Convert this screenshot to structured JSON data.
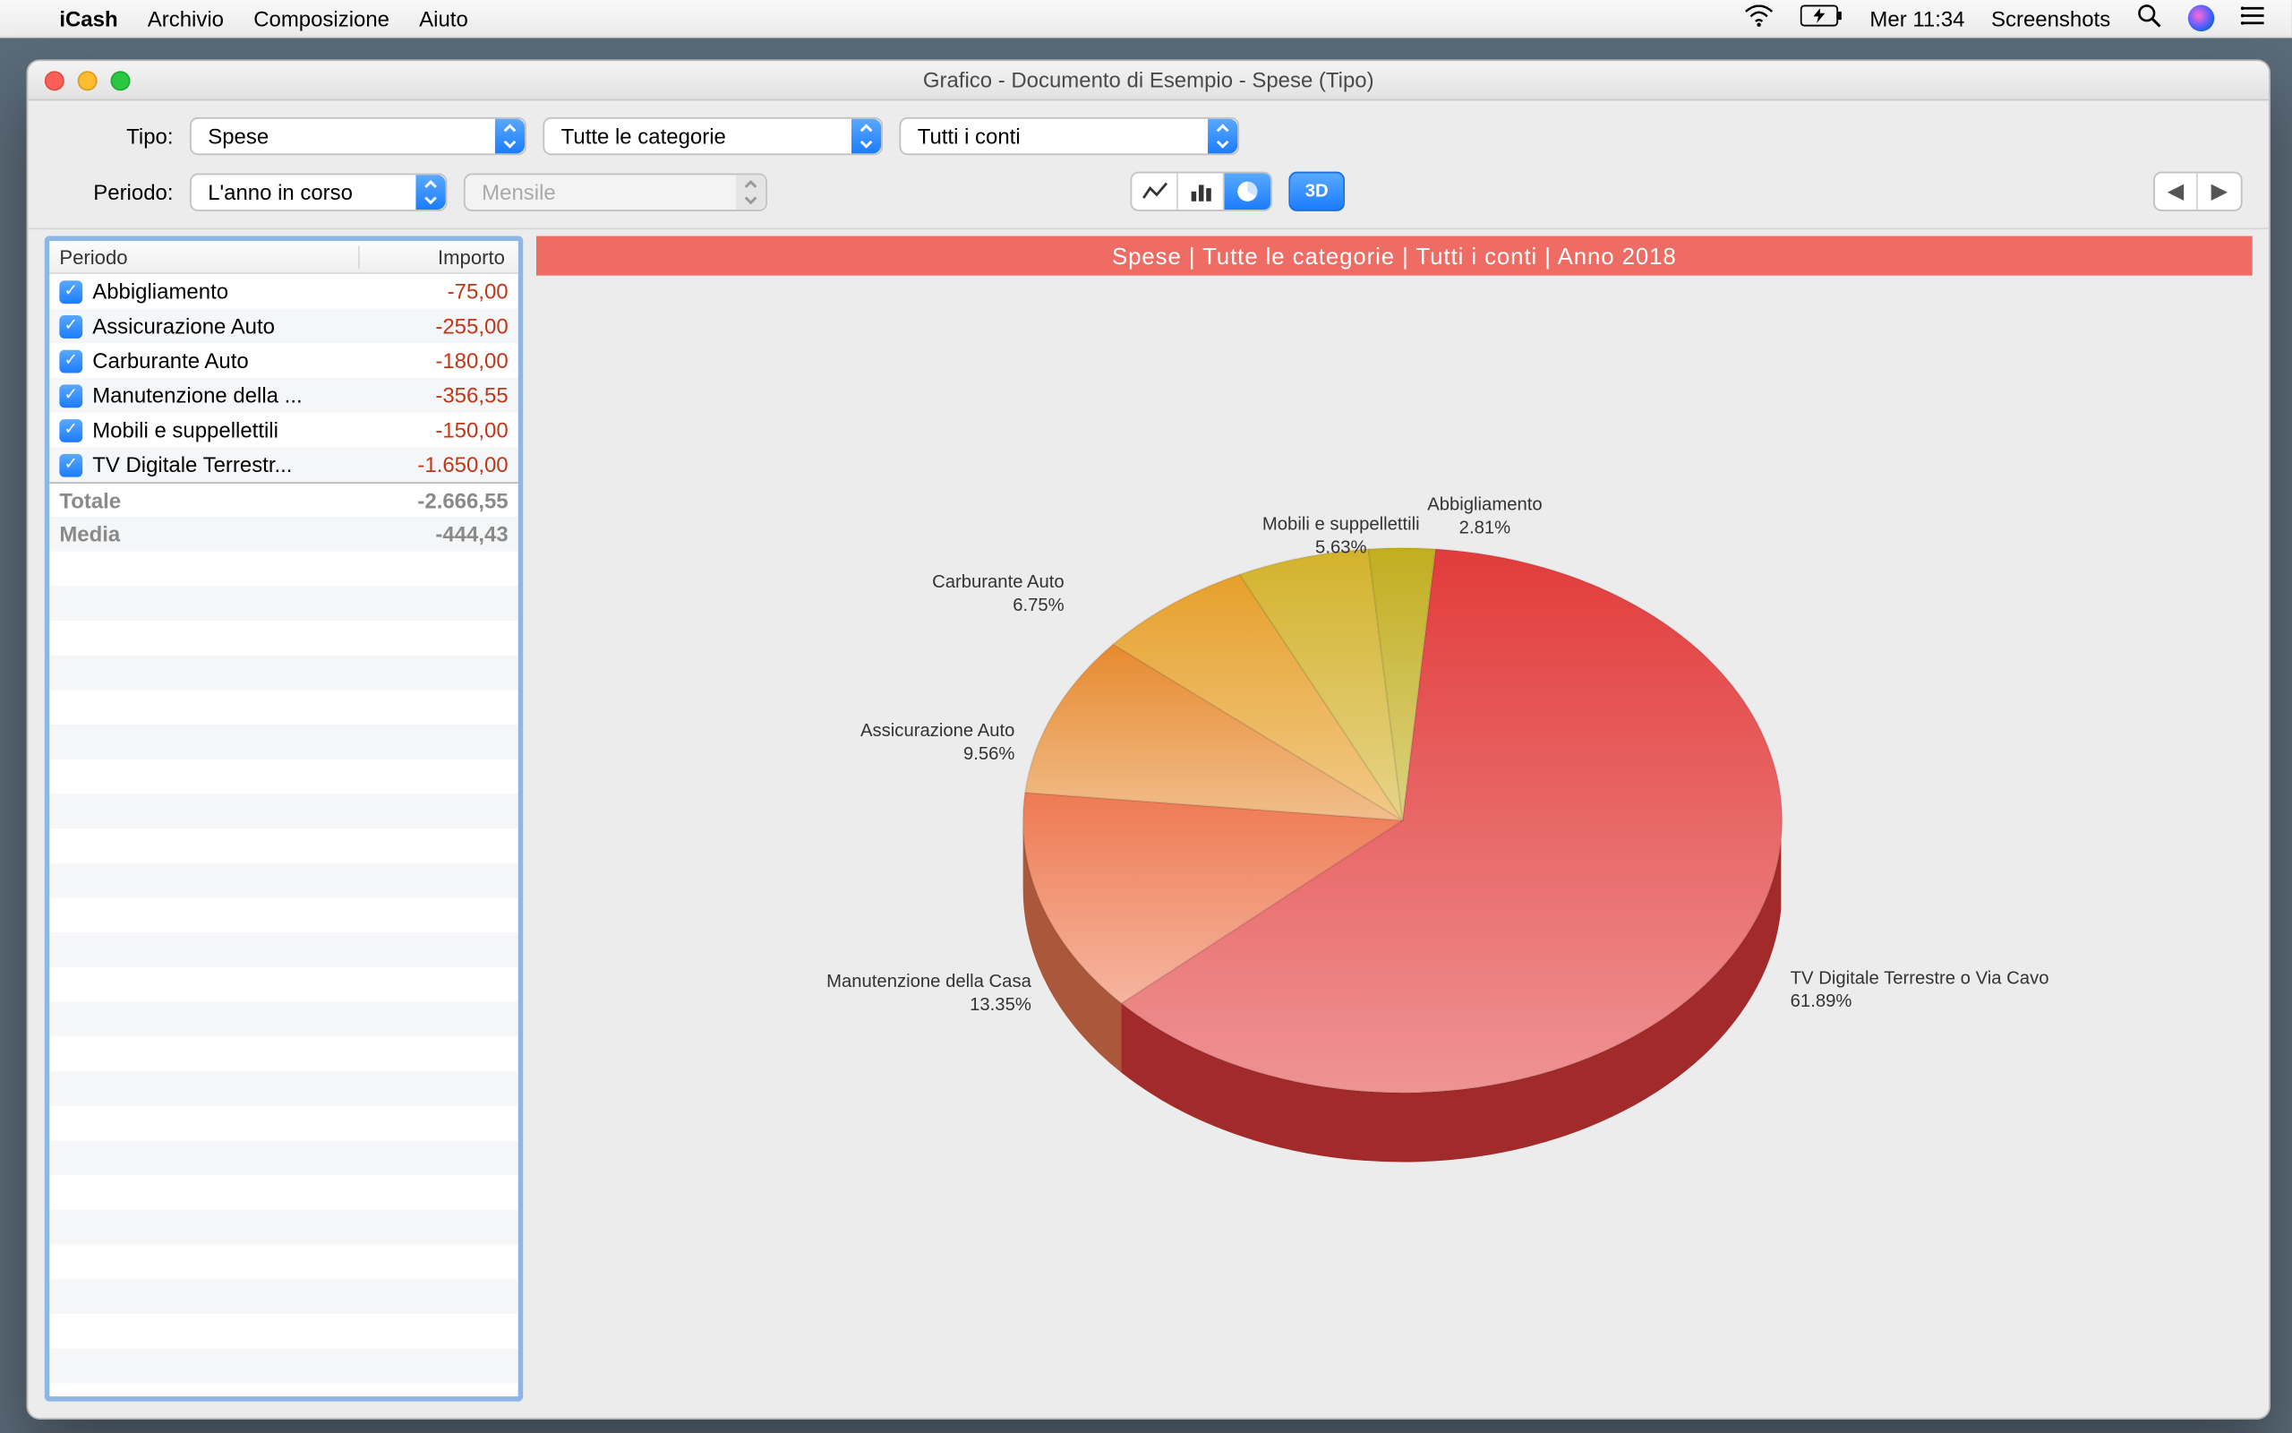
{
  "menubar": {
    "app": "iCash",
    "items": [
      "Archivio",
      "Composizione",
      "Aiuto"
    ],
    "clock": "Mer 11:34",
    "right_app": "Screenshots"
  },
  "window": {
    "title": "Grafico - Documento di Esempio - Spese (Tipo)"
  },
  "toolbar": {
    "type_label": "Tipo:",
    "type_value": "Spese",
    "category_value": "Tutte le categorie",
    "account_value": "Tutti i conti",
    "period_label": "Periodo:",
    "period_value": "L'anno in corso",
    "interval_value": "Mensile",
    "btn3d": "3D"
  },
  "table": {
    "col_period": "Periodo",
    "col_amount": "Importo",
    "rows": [
      {
        "name": "Abbigliamento",
        "amount": "-75,00"
      },
      {
        "name": "Assicurazione Auto",
        "amount": "-255,00"
      },
      {
        "name": "Carburante Auto",
        "amount": "-180,00"
      },
      {
        "name": "Manutenzione della ...",
        "amount": "-356,55"
      },
      {
        "name": "Mobili e suppellettili",
        "amount": "-150,00"
      },
      {
        "name": "TV Digitale Terrestr...",
        "amount": "-1.650,00"
      }
    ],
    "total_label": "Totale",
    "total_value": "-2.666,55",
    "mean_label": "Media",
    "mean_value": "-444,43"
  },
  "chart": {
    "title": "Spese | Tutte le categorie | Tutti i conti | Anno 2018"
  },
  "chart_data": {
    "type": "pie",
    "title": "Spese | Tutte le categorie | Tutti i conti | Anno 2018",
    "series": [
      {
        "name": "TV Digitale Terrestre o Via Cavo",
        "value": 1650.0,
        "pct": 61.89,
        "color": "#e23b3b"
      },
      {
        "name": "Manutenzione della Casa",
        "value": 356.55,
        "pct": 13.35,
        "color": "#ee7a52"
      },
      {
        "name": "Assicurazione Auto",
        "value": 255.0,
        "pct": 9.56,
        "color": "#e78a2f"
      },
      {
        "name": "Carburante Auto",
        "value": 180.0,
        "pct": 6.75,
        "color": "#e6a02a"
      },
      {
        "name": "Mobili e suppellettili",
        "value": 150.0,
        "pct": 5.63,
        "color": "#d3b22b"
      },
      {
        "name": "Abbigliamento",
        "value": 75.0,
        "pct": 2.81,
        "color": "#c2ae1f"
      }
    ],
    "labels": [
      {
        "line1": "TV Digitale Terrestre o Via Cavo",
        "line2": "61.89%",
        "x": 760,
        "y": 420,
        "align": "right"
      },
      {
        "line1": "Manutenzione della Casa",
        "line2": "13.35%",
        "x": 300,
        "y": 422,
        "align": "left"
      },
      {
        "line1": "Assicurazione Auto",
        "line2": "9.56%",
        "x": 290,
        "y": 270,
        "align": "left"
      },
      {
        "line1": "Carburante Auto",
        "line2": "6.75%",
        "x": 320,
        "y": 180,
        "align": "left"
      },
      {
        "line1": "Mobili e suppellettili",
        "line2": "5.63%",
        "x": 440,
        "y": 145,
        "align": "center"
      },
      {
        "line1": "Abbigliamento",
        "line2": "2.81%",
        "x": 540,
        "y": 133,
        "align": "center"
      }
    ]
  }
}
